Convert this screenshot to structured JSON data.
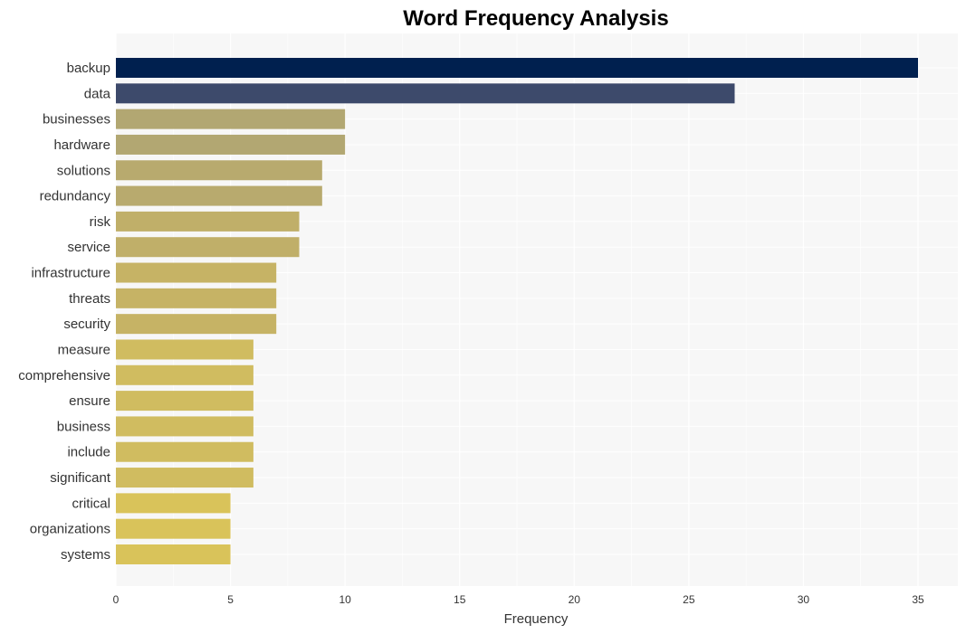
{
  "chart_data": {
    "type": "bar",
    "orientation": "horizontal",
    "title": "Word Frequency Analysis",
    "xlabel": "Frequency",
    "ylabel": "",
    "xlim": [
      0,
      36.8
    ],
    "xticks": [
      0,
      5,
      10,
      15,
      20,
      25,
      30,
      35
    ],
    "grid": true,
    "legend": "none",
    "categories": [
      "backup",
      "data",
      "businesses",
      "hardware",
      "solutions",
      "redundancy",
      "risk",
      "service",
      "infrastructure",
      "threats",
      "security",
      "measure",
      "comprehensive",
      "ensure",
      "business",
      "include",
      "significant",
      "critical",
      "organizations",
      "systems"
    ],
    "values": [
      35,
      27,
      10,
      10,
      9,
      9,
      8,
      8,
      7,
      7,
      7,
      6,
      6,
      6,
      6,
      6,
      6,
      5,
      5,
      5
    ],
    "colors": [
      "#00204f",
      "#3d4a6b",
      "#b2a772",
      "#b2a772",
      "#b8aa6e",
      "#b8aa6e",
      "#c0af69",
      "#c0af69",
      "#c6b365",
      "#c6b365",
      "#c6b365",
      "#d0bc60",
      "#d0bc60",
      "#d0bc60",
      "#d0bc60",
      "#d0bc60",
      "#d0bc60",
      "#d9c35a",
      "#d9c35a",
      "#d9c35a"
    ],
    "background_color": "#f7f7f7",
    "grid_color": "#ffffff"
  }
}
